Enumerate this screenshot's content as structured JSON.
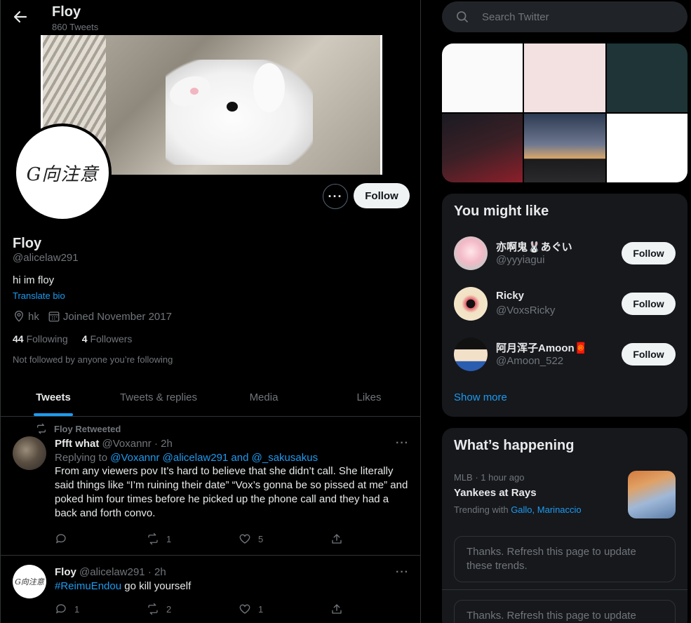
{
  "header": {
    "title": "Floy",
    "tweet_count": "860 Tweets"
  },
  "profile": {
    "avatar_text": "G向注意",
    "name": "Floy",
    "handle": "@alicelaw291",
    "bio": "hi im floy",
    "translate": "Translate bio",
    "location": "hk",
    "joined": "Joined November 2017",
    "following_count": "44",
    "following_label": "Following",
    "followers_count": "4",
    "followers_label": "Followers",
    "not_followed": "Not followed by anyone you’re following",
    "follow_label": "Follow"
  },
  "tabs": [
    "Tweets",
    "Tweets & replies",
    "Media",
    "Likes"
  ],
  "tweets": [
    {
      "retweeted_by": "Floy Retweeted",
      "name": "Pfft what",
      "handle": "@Voxannr",
      "time": "· 2h",
      "replying_prefix": "Replying to",
      "replying_to": "@Voxannr @alicelaw291 and @_sakusakus",
      "text": "From any viewers pov It’s hard to believe that she didn’t call. She literally said things like “I’m ruining their date” “Vox’s gonna be so pissed at me” and poked him four times before he picked up the phone call and they had a back and forth convo.",
      "replies": "",
      "retweets": "1",
      "likes": "5"
    },
    {
      "name": "Floy",
      "handle": "@alicelaw291",
      "time": "· 2h",
      "hashtag": "#ReimuEndou",
      "text": "go kill yourself",
      "replies": "1",
      "retweets": "2",
      "likes": "1"
    }
  ],
  "sidebar": {
    "search_placeholder": "Search Twitter",
    "who_to_follow": {
      "title": "You might like",
      "users": [
        {
          "name": "亦啊鬼🐰あぐい",
          "handle": "@yyyiagui",
          "button": "Follow"
        },
        {
          "name": "Ricky",
          "handle": "@VoxsRicky",
          "button": "Follow"
        },
        {
          "name": "阿月浑子Amoon🧧",
          "handle": "@Amoon_522",
          "button": "Follow"
        }
      ],
      "show_more": "Show more"
    },
    "happening": {
      "title": "What’s happening",
      "trend_category": "MLB · 1 hour ago",
      "trend_title": "Yankees at Rays",
      "trending_with_label": "Trending with",
      "trending_with_1": "Gallo",
      "trending_with_2": "Marinaccio",
      "refresh_1": "Thanks. Refresh this page to update these trends.",
      "refresh_2": "Thanks. Refresh this page to update"
    }
  },
  "colors": {
    "accent": "#1d9bf0",
    "background": "#000000",
    "card": "#16181c",
    "muted": "#71767b"
  }
}
